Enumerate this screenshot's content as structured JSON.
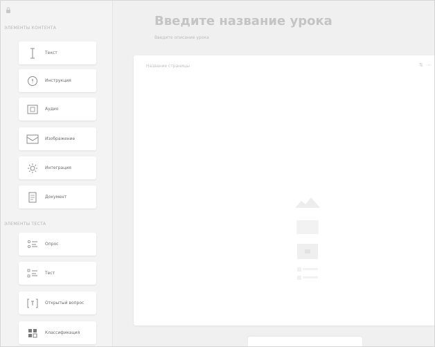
{
  "sidebar": {
    "section_content": "Элементы контента",
    "section_test": "Элементы теста",
    "content_items": [
      {
        "label": "Текст",
        "icon": "text-cursor-icon"
      },
      {
        "label": "Инструкция",
        "icon": "info-circle-icon"
      },
      {
        "label": "Аудио",
        "icon": "audio-box-icon"
      },
      {
        "label": "Изображение",
        "icon": "image-icon"
      },
      {
        "label": "Интеграция",
        "icon": "integration-gear-icon"
      },
      {
        "label": "Документ",
        "icon": "document-icon"
      }
    ],
    "test_items": [
      {
        "label": "Опрос",
        "icon": "survey-list-icon"
      },
      {
        "label": "Тест",
        "icon": "test-list-icon"
      },
      {
        "label": "Открытый вопрос",
        "icon": "open-question-icon"
      },
      {
        "label": "Классификация",
        "icon": "classification-grid-icon"
      }
    ]
  },
  "main": {
    "title": "Введите название урока",
    "subtitle": "Введите описание урока",
    "page_name_placeholder": "Название страницы",
    "page_actions": [
      "⇅",
      "⋯"
    ]
  }
}
